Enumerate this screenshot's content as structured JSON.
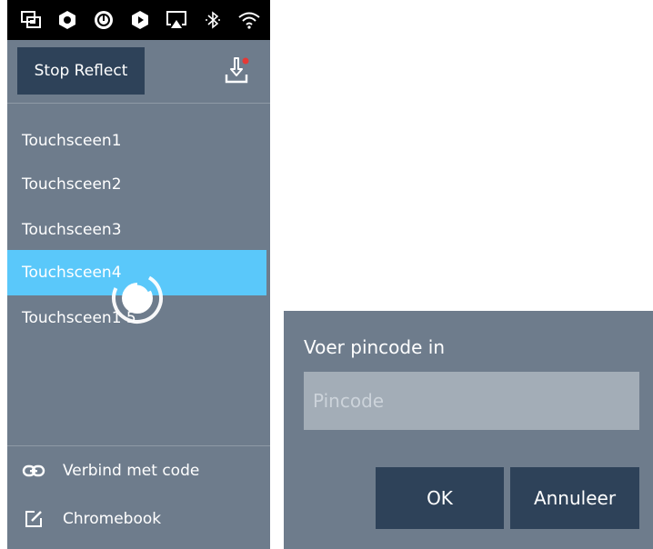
{
  "statusbar": {
    "icons": [
      "screen-mirror-icon",
      "app-hexagon-icon",
      "power-circle-icon",
      "shield-app-icon",
      "airplay-icon",
      "bluetooth-icon",
      "wifi-icon"
    ]
  },
  "sidebar": {
    "stop_reflect_label": "Stop Reflect",
    "download_icon": "download-icon",
    "devices": [
      {
        "label": "Touchsceen1",
        "selected": false
      },
      {
        "label": "Touchsceen2",
        "selected": false
      },
      {
        "label": "Touchsceen3",
        "selected": false
      },
      {
        "label": "Touchsceen4",
        "selected": true
      },
      {
        "label": "Touchsceen1 5",
        "selected": false
      }
    ],
    "bottom": [
      {
        "label": "Verbind met code",
        "icon": "link-icon"
      },
      {
        "label": "Chromebook",
        "icon": "edit-icon"
      }
    ]
  },
  "dialog": {
    "title": "Voer pincode in",
    "input": {
      "value": "",
      "placeholder": "Pincode"
    },
    "ok_label": "OK",
    "cancel_label": "Annuleer"
  },
  "colors": {
    "panel": "#6e7c8c",
    "button": "#2e4259",
    "selected": "#5ac8fa",
    "input": "#a3adb7",
    "badge": "#e53935"
  }
}
